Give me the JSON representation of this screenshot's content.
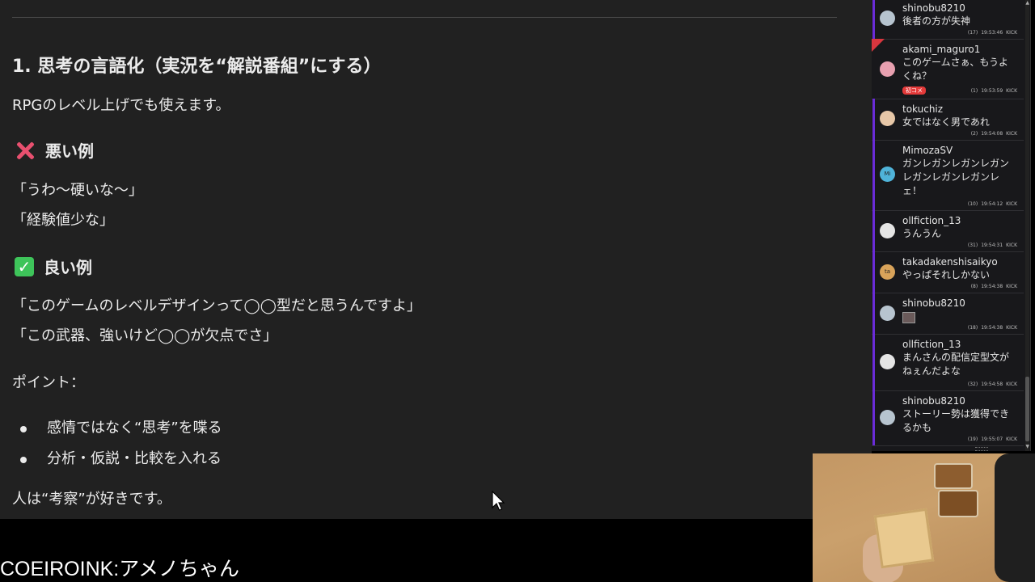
{
  "document": {
    "heading": "1. 思考の言語化（実況を“解説番組”にする）",
    "intro": "RPGのレベル上げでも使えます。",
    "bad_example": {
      "title": "悪い例",
      "lines": [
        "「うわ〜硬いな〜」",
        "「経験値少な」"
      ]
    },
    "good_example": {
      "title": "良い例",
      "lines": [
        "「このゲームのレベルデザインって◯◯型だと思うんですよ」",
        "「この武器、強いけど◯◯が欠点でさ」"
      ]
    },
    "points_label": "ポイント：",
    "points": [
      "感情ではなく“思考”を喋る",
      "分析・仮説・比較を入れる"
    ],
    "closing": "人は“考察”が好きです。"
  },
  "chat": {
    "messages": [
      {
        "user": "shinobu8210",
        "text": "後者の方が失神",
        "count": "(17)",
        "time": "19:53:46",
        "action": "KICK",
        "avatar": "",
        "avatar_color": "#b7c4cf"
      },
      {
        "user": "akami_maguro1",
        "text": "このゲームさぁ、もうよくね？",
        "badge": "初コメ",
        "count": "(1)",
        "time": "19:53:59",
        "action": "KICK",
        "avatar": "",
        "avatar_color": "#e8a0b0"
      },
      {
        "user": "tokuchiz",
        "text": "女ではなく男であれ",
        "count": "(2)",
        "time": "19:54:08",
        "action": "KICK",
        "avatar": "",
        "avatar_color": "#e7c7a8"
      },
      {
        "user": "MimozaSV",
        "text": "ガンレガンレガンレガンレガンレガンレガンレェ！",
        "count": "(10)",
        "time": "19:54:12",
        "action": "KICK",
        "avatar": "Mi",
        "avatar_color": "#4fb3d9"
      },
      {
        "user": "ollfiction_13",
        "text": "うんうん",
        "count": "(31)",
        "time": "19:54:31",
        "action": "KICK",
        "avatar": "",
        "avatar_color": "#e5e5e5"
      },
      {
        "user": "takadakenshisaikyo",
        "text": "やっぱそれしかない",
        "count": "(8)",
        "time": "19:54:38",
        "action": "KICK",
        "avatar": "ta",
        "avatar_color": "#d9a35a"
      },
      {
        "user": "shinobu8210",
        "text": "",
        "count": "(18)",
        "time": "19:54:38",
        "action": "KICK",
        "avatar": "",
        "avatar_color": "#b7c4cf"
      },
      {
        "user": "ollfiction_13",
        "text": "まんさんの配信定型文がねぇんだよな",
        "count": "(32)",
        "time": "19:54:58",
        "action": "KICK",
        "avatar": "",
        "avatar_color": "#e5e5e5"
      },
      {
        "user": "shinobu8210",
        "text": "ストーリー勢は獲得できるかも",
        "count": "(19)",
        "time": "19:55:07",
        "action": "KICK",
        "avatar": "",
        "avatar_color": "#b7c4cf"
      }
    ]
  },
  "caption": "COEIROINK:アメノちゃん"
}
